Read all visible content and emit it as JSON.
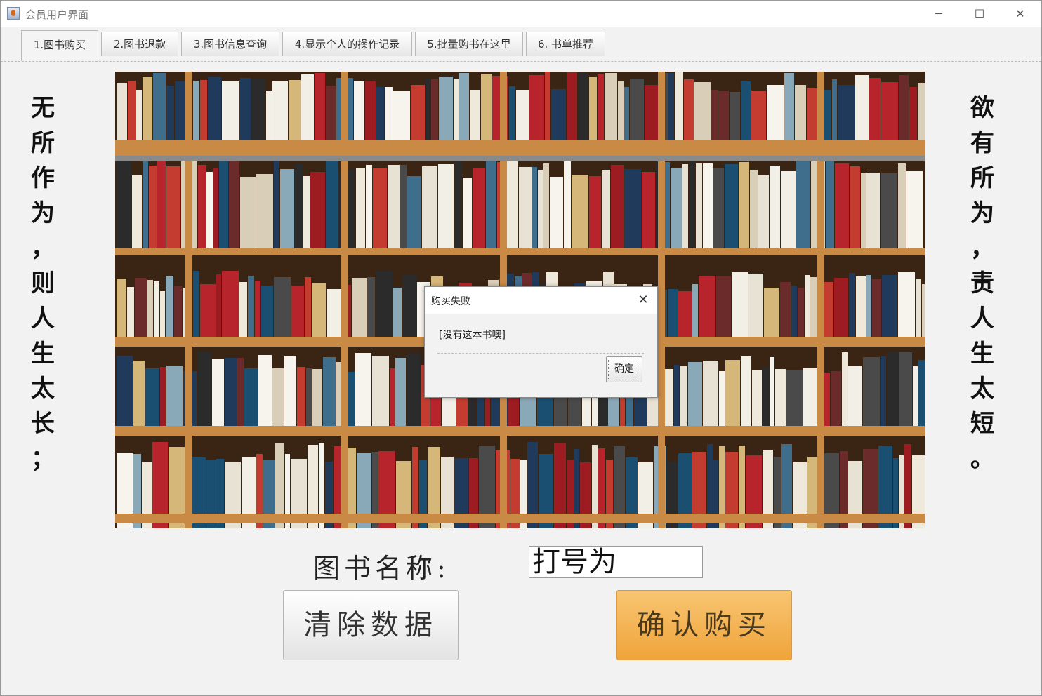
{
  "window": {
    "title": "会员用户界面",
    "minimize": "─",
    "maximize": "☐",
    "close": "✕"
  },
  "tabs": [
    {
      "label": "1.图书购买"
    },
    {
      "label": "2.图书退款"
    },
    {
      "label": "3.图书信息查询"
    },
    {
      "label": "4.显示个人的操作记录"
    },
    {
      "label": "5.批量购书在这里"
    },
    {
      "label": "6. 书单推荐"
    }
  ],
  "poem": {
    "left": [
      "无",
      "所",
      "作",
      "为",
      "，",
      "则",
      "人",
      "生",
      "太",
      "长",
      "；"
    ],
    "right": [
      "欲",
      "有",
      "所",
      "为",
      "，",
      "责",
      "人",
      "生",
      "太",
      "短",
      "。"
    ]
  },
  "form": {
    "book_name_label": "图书名称:",
    "book_name_value": "打号为",
    "clear_button": "清除数据",
    "buy_button": "确认购买"
  },
  "dialog": {
    "title": "购买失败",
    "message": "[没有这本书噢]",
    "ok": "确定",
    "close": "✕"
  }
}
